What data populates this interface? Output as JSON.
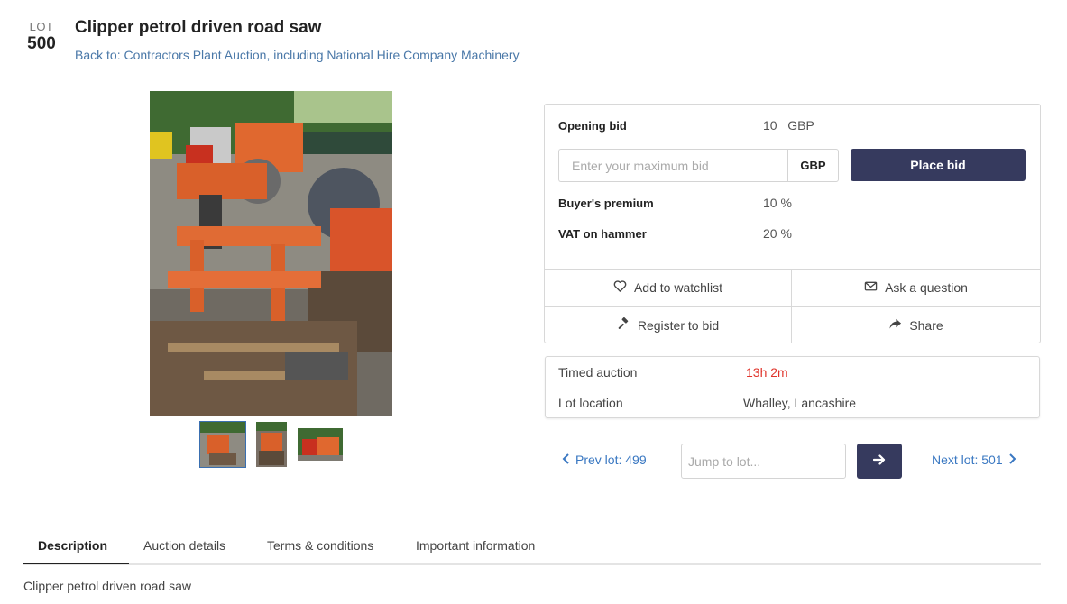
{
  "lot": {
    "word": "LOT",
    "number": "500"
  },
  "title": "Clipper petrol driven road saw",
  "back_link": "Back to: Contractors Plant Auction, including National Hire Company Machinery",
  "bid": {
    "opening_label": "Opening bid",
    "opening_value": "10   GBP",
    "input_placeholder": "Enter your maximum bid",
    "currency": "GBP",
    "place_bid_label": "Place bid",
    "premium_label": "Buyer's premium",
    "premium_value": "10 %",
    "vat_label": "VAT on hammer",
    "vat_value": "20 %"
  },
  "actions": {
    "watchlist": "Add to watchlist",
    "ask": "Ask a question",
    "register": "Register to bid",
    "share": "Share"
  },
  "info": {
    "auction_type": "Timed auction",
    "time_left": "13h 2m",
    "location_label": "Lot location",
    "location_value": "Whalley, Lancashire"
  },
  "nav": {
    "prev": "Prev lot: 499",
    "jump_placeholder": "Jump to lot...",
    "next": "Next lot: 501"
  },
  "tabs": [
    "Description",
    "Auction details",
    "Terms & conditions",
    "Important information"
  ],
  "description": "Clipper petrol driven road saw",
  "colors": {
    "primary_button": "#363a5e",
    "link": "#3a78c2",
    "countdown": "#e0342b"
  }
}
